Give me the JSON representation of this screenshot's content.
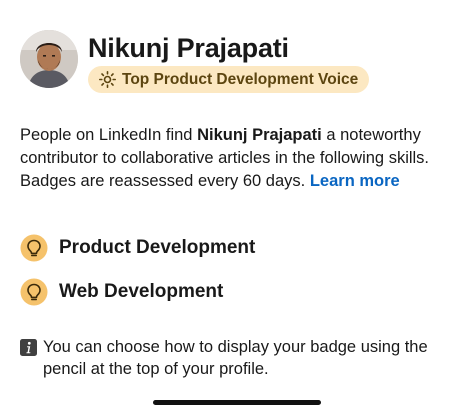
{
  "profile": {
    "name": "Nikunj Prajapati",
    "badge_text": "Top Product Development Voice",
    "avatar_icon": "person-avatar"
  },
  "description": {
    "prefix": "People on LinkedIn find ",
    "name": "Nikunj Prajapati",
    "middle": " a noteworthy contributor to collaborative articles in the following skills. Badges are reassessed every 60 days. ",
    "link": "Learn more"
  },
  "skills": [
    {
      "label": "Product Development",
      "icon": "lightbulb-icon"
    },
    {
      "label": "Web Development",
      "icon": "lightbulb-icon"
    }
  ],
  "note": {
    "icon": "info-icon",
    "text": "You can choose how to display your badge using the pencil at the top of your profile."
  },
  "colors": {
    "badge_background": "#fce8c2",
    "badge_text": "#5c4510",
    "link": "#0a66c2",
    "skill_icon": "#f5c26b"
  }
}
